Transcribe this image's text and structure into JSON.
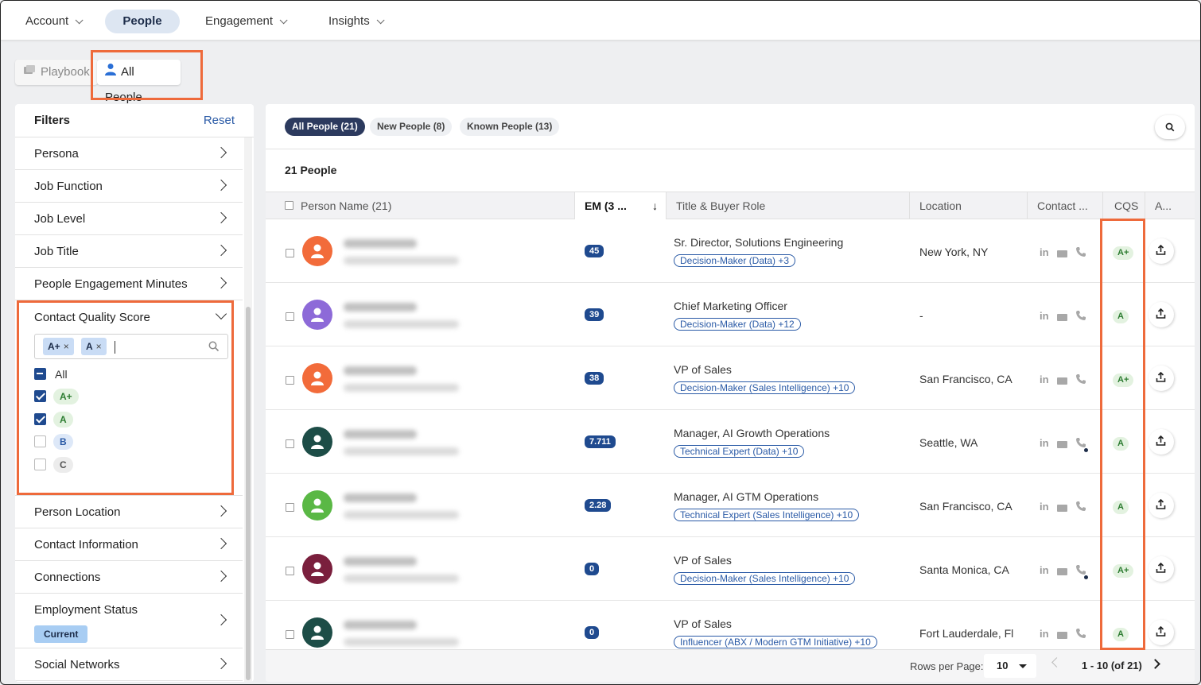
{
  "nav": {
    "items": [
      {
        "label": "Account",
        "dropdown": true,
        "active": false
      },
      {
        "label": "People",
        "dropdown": false,
        "active": true
      },
      {
        "label": "Engagement",
        "dropdown": true,
        "active": false
      },
      {
        "label": "Insights",
        "dropdown": true,
        "active": false
      }
    ]
  },
  "page_tabs": {
    "playbook": "Playbook",
    "all_people": "All People"
  },
  "filters": {
    "title": "Filters",
    "reset": "Reset",
    "items_before": [
      "Persona",
      "Job Function",
      "Job Level",
      "Job Title",
      "People Engagement Minutes"
    ],
    "cqs": {
      "label": "Contact Quality Score",
      "selected_tags": [
        "A+",
        "A"
      ],
      "all_label": "All",
      "options": [
        {
          "grade": "A+",
          "checked": true
        },
        {
          "grade": "A",
          "checked": true
        },
        {
          "grade": "B",
          "checked": false
        },
        {
          "grade": "C",
          "checked": false
        }
      ]
    },
    "items_after": [
      "Person Location",
      "Contact Information",
      "Connections"
    ],
    "employment": {
      "label": "Employment Status",
      "value": "Current"
    },
    "social": "Social Networks"
  },
  "segments": [
    "All People (21)",
    "New People (8)",
    "Known People (13)"
  ],
  "table": {
    "count_title": "21 People",
    "headers": {
      "name": "Person Name (21)",
      "em": "EM (3 ...",
      "title": "Title & Buyer Role",
      "location": "Location",
      "contact": "Contact ...",
      "cqs": "CQS",
      "actions": "A..."
    },
    "rows": [
      {
        "em": "45",
        "title": "Sr. Director, Solutions Engineering",
        "role": "Decision-Maker (Data) +3",
        "location": "New York, NY",
        "cqs": "A+",
        "avatar_color": "#f26b3a",
        "phone_dot": false
      },
      {
        "em": "39",
        "title": "Chief Marketing Officer",
        "role": "Decision-Maker (Data) +12",
        "location": "-",
        "cqs": "A",
        "avatar_color": "#8d6ad8",
        "phone_dot": false
      },
      {
        "em": "38",
        "title": "VP of Sales",
        "role": "Decision-Maker (Sales Intelligence) +10",
        "location": "San Francisco, CA",
        "cqs": "A+",
        "avatar_color": "#f26b3a",
        "phone_dot": false
      },
      {
        "em": "7.711",
        "title": "Manager, AI Growth Operations",
        "role": "Technical Expert (Data) +10",
        "location": "Seattle, WA",
        "cqs": "A",
        "avatar_color": "#1d4d47",
        "phone_dot": true
      },
      {
        "em": "2.28",
        "title": "Manager, AI GTM Operations",
        "role": "Technical Expert (Sales Intelligence) +10",
        "location": "San Francisco, CA",
        "cqs": "A",
        "avatar_color": "#5ab845",
        "phone_dot": false
      },
      {
        "em": "0",
        "title": "VP of Sales",
        "role": "Decision-Maker (Sales Intelligence) +10",
        "location": "Santa Monica, CA",
        "cqs": "A+",
        "avatar_color": "#7a1f3d",
        "phone_dot": true
      },
      {
        "em": "0",
        "title": "VP of Sales",
        "role": "Influencer (ABX / Modern GTM Initiative) +10",
        "location": "Fort Lauderdale, Fl",
        "cqs": "A",
        "avatar_color": "#1d4d47",
        "phone_dot": false
      }
    ]
  },
  "footer": {
    "rows_per_page_label": "Rows per Page:",
    "rows_per_page": "10",
    "range": "1 - 10 (of 21)"
  },
  "colors": {
    "accent": "#1f4a8f",
    "highlight": "#ee6a3b",
    "grade_green": "#2e7d32"
  }
}
